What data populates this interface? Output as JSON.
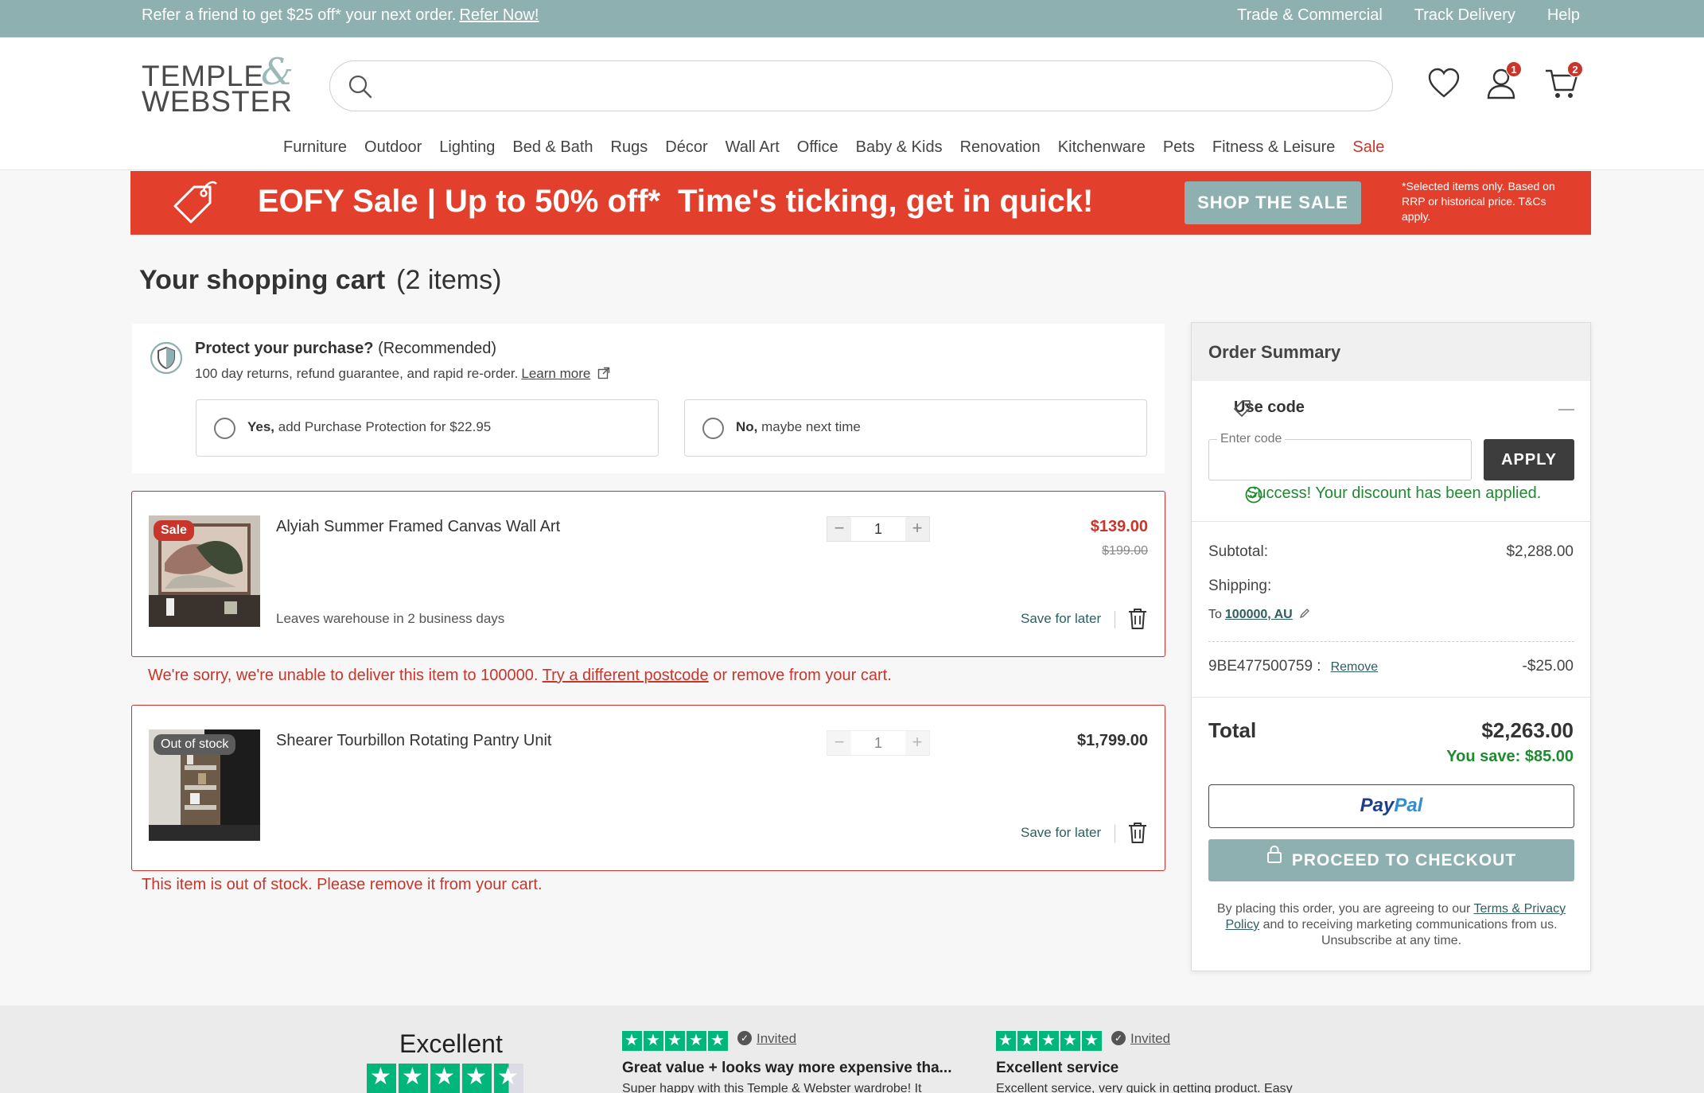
{
  "topbar": {
    "promo_text": "Refer a friend to get $25 off* your next order.",
    "promo_link": "Refer Now!",
    "links": [
      "Trade & Commercial",
      "Track Delivery",
      "Help"
    ]
  },
  "header": {
    "logo_line1": "TEMPLE",
    "logo_line2": "WEBSTER",
    "logo_amp": "&",
    "search_value": "",
    "account_badge": "1",
    "cart_badge": "2",
    "icons": [
      "search-icon",
      "heart-icon",
      "user-icon",
      "cart-icon"
    ]
  },
  "nav": [
    "Furniture",
    "Outdoor",
    "Lighting",
    "Bed & Bath",
    "Rugs",
    "Décor",
    "Wall Art",
    "Office",
    "Baby & Kids",
    "Renovation",
    "Kitchenware",
    "Pets",
    "Fitness & Leisure",
    "Sale"
  ],
  "banner": {
    "headline": "EOFY Sale | Up to 50% off*",
    "sub": "Time's ticking, get in quick!",
    "cta": "SHOP THE SALE",
    "fine_print": "*Selected items only. Based on RRP or historical price. T&Cs apply."
  },
  "cart": {
    "title": "Your shopping cart",
    "count": "(2 items)"
  },
  "protect": {
    "title": "Protect your purchase?",
    "recommended": "(Recommended)",
    "desc": "100 day returns, refund guarantee, and rapid re-order.",
    "learn_more": "Learn more",
    "yes_bold": "Yes,",
    "yes_text": "add Purchase Protection for $22.95",
    "no_bold": "No,",
    "no_text": "maybe next time"
  },
  "items": [
    {
      "name": "Alyiah Summer Framed Canvas Wall Art",
      "tag": "Sale",
      "qty": "1",
      "price": "$139.00",
      "old_price": "$199.00",
      "shipping": "Leaves warehouse in 2 business days",
      "save_later": "Save for later",
      "error_pre": "We're sorry, we're unable to deliver this item to 100000.",
      "error_link": "Try a different postcode",
      "error_post": "or remove from your cart."
    },
    {
      "name": "Shearer Tourbillon Rotating Pantry Unit",
      "tag": "Out of stock",
      "qty": "1",
      "price": "$1,799.00",
      "save_later": "Save for later",
      "error": "This item is out of stock. Please remove it from your cart."
    }
  ],
  "summary": {
    "title": "Order Summary",
    "use_code": "Use code",
    "code_label": "Enter code",
    "code_value": "",
    "apply": "APPLY",
    "success": "Success! Your discount has been applied.",
    "subtotal_label": "Subtotal:",
    "subtotal_value": "$2,288.00",
    "shipping_label": "Shipping:",
    "ship_to": "To",
    "ship_postcode": "100000, AU",
    "coupon_code": "9BE477500759 :",
    "remove": "Remove",
    "coupon_value": "-$25.00",
    "total_label": "Total",
    "total_value": "$2,263.00",
    "you_save": "You save: $85.00",
    "paypal_1": "Pay",
    "paypal_2": "Pal",
    "checkout": "PROCEED TO CHECKOUT",
    "legal_1": "By placing this order, you are agreeing to our",
    "legal_link": "Terms & Privacy Policy",
    "legal_2": "and to receiving marketing communications from us. Unsubscribe at any time."
  },
  "reviews": {
    "rating_word": "Excellent",
    "items": [
      {
        "invited": "Invited",
        "title": "Great value + looks way more expensive tha...",
        "body": "Super happy with this Temple & Webster wardrobe! It"
      },
      {
        "invited": "Invited",
        "title": "Excellent service",
        "body": "Excellent service, very quick in getting product. Easy"
      }
    ]
  },
  "colors": {
    "teal": "#8fb0b0",
    "sale_red": "#c8362b",
    "banner_red": "#e2402d",
    "success_green": "#1f8a30",
    "trustpilot_green": "#00b67a"
  }
}
